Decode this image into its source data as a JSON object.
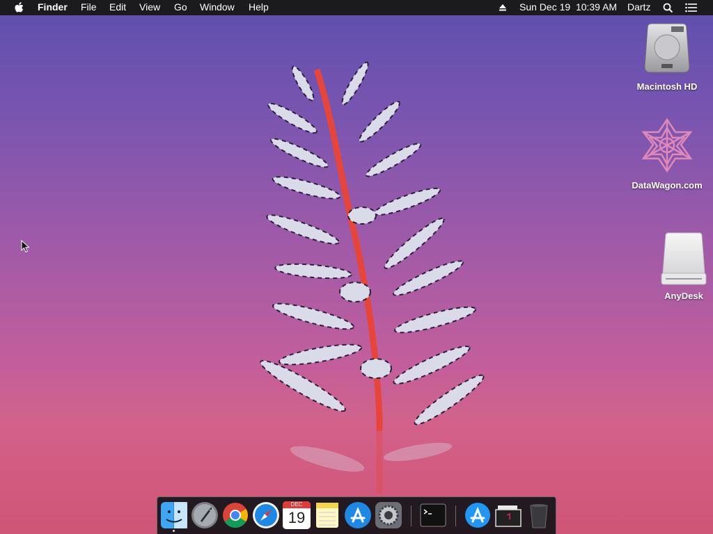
{
  "menubar": {
    "app_name": "Finder",
    "menus": [
      "File",
      "Edit",
      "View",
      "Go",
      "Window",
      "Help"
    ],
    "datetime": "Sun Dec 19  10:39 AM",
    "user": "Dartz"
  },
  "desktop": {
    "icons": [
      {
        "label": "Macintosh HD"
      },
      {
        "label": "DataWagon.com"
      },
      {
        "label": "AnyDesk"
      }
    ]
  },
  "dock": {
    "calendar": {
      "month": "DEC",
      "day": "19"
    },
    "apps": [
      "finder-icon",
      "launchpad-icon",
      "chrome-icon",
      "safari-icon",
      "calendar-icon",
      "notes-icon",
      "app-store-icon",
      "system-preferences-icon",
      "terminal-icon",
      "applications-folder-icon",
      "downloads-stack-icon",
      "trash-icon"
    ]
  },
  "colors": {
    "menubar_bg": "#1b1b1d",
    "wallpaper_top": "#5d4fae",
    "wallpaper_bottom": "#c95473",
    "plant_stem": "#e8453a"
  }
}
